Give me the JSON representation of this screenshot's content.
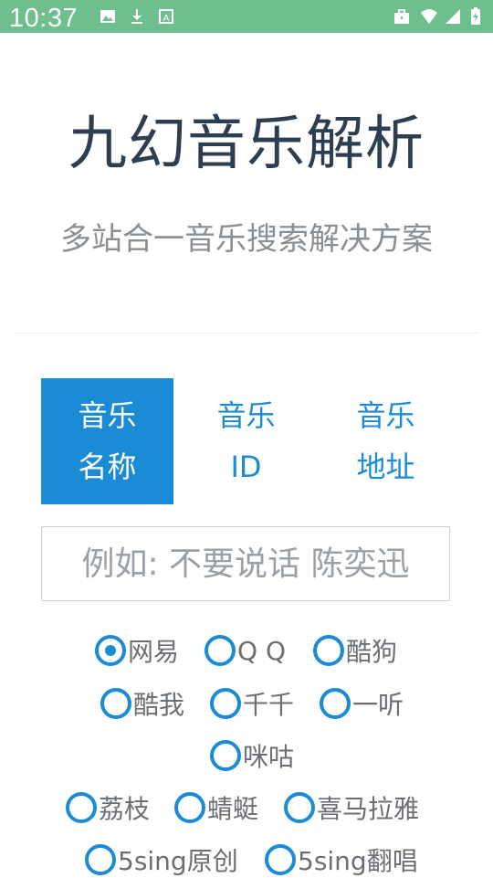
{
  "status_bar": {
    "time": "10:37",
    "left_icons": [
      "image-icon",
      "download-icon",
      "font-icon"
    ],
    "right_icons": [
      "briefcase-icon",
      "wifi-icon",
      "signal-icon",
      "battery-icon"
    ],
    "bg_color": "#6fbf8e"
  },
  "header": {
    "title": "九幻音乐解析",
    "subtitle": "多站合一音乐搜索解决方案"
  },
  "tabs": [
    {
      "line1": "音乐",
      "line2": "名称",
      "active": true
    },
    {
      "line1": "音乐",
      "line2": "ID",
      "active": false
    },
    {
      "line1": "音乐",
      "line2": "地址",
      "active": false
    }
  ],
  "search": {
    "value": "",
    "placeholder": "例如: 不要说话 陈奕迅"
  },
  "sources": [
    {
      "label": "网易",
      "checked": true
    },
    {
      "label": "Q Q",
      "checked": false
    },
    {
      "label": "酷狗",
      "checked": false
    },
    {
      "label": "酷我",
      "checked": false
    },
    {
      "label": "千千",
      "checked": false
    },
    {
      "label": "一听",
      "checked": false
    },
    {
      "label": "咪咕",
      "checked": false
    },
    {
      "label": "荔枝",
      "checked": false
    },
    {
      "label": "蜻蜓",
      "checked": false
    },
    {
      "label": "喜马拉雅",
      "checked": false
    },
    {
      "label": "5sing原创",
      "checked": false
    },
    {
      "label": "5sing翻唱",
      "checked": false
    }
  ],
  "colors": {
    "accent": "#1a8bd4",
    "title": "#2c3e50",
    "subtitle": "#8a8f94"
  }
}
